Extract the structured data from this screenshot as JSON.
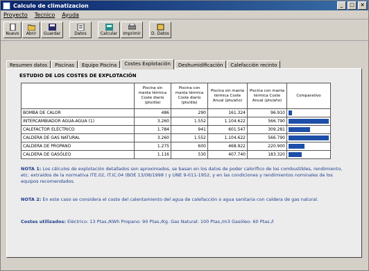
{
  "window": {
    "title": "Calculo de climatizacion"
  },
  "menu": [
    "Proyecto",
    "Tecnico",
    "Ayuda"
  ],
  "toolbar": {
    "buttons": [
      {
        "label": "Nuevo",
        "icon": "new-file-icon"
      },
      {
        "label": "Abrir",
        "icon": "open-folder-icon"
      },
      {
        "label": "Guardar",
        "icon": "save-disk-icon"
      },
      {
        "label": "Datos",
        "icon": "data-icon"
      },
      {
        "label": "Calcular",
        "icon": "calculator-icon"
      },
      {
        "label": "Imprimir",
        "icon": "printer-icon"
      },
      {
        "label": "D. Datos",
        "icon": "database-icon"
      }
    ]
  },
  "tabs": [
    "Resumen datos",
    "Piscinas",
    "Equipo Piscina",
    "Costes Explotación",
    "Deshumidificación",
    "Calefacción recinto"
  ],
  "active_tab": 3,
  "panel": {
    "title": "ESTUDIO DE LOS COSTES DE EXPLOTACIÓN",
    "columns": [
      "Piscina sin manta térmica Coste diario (pts/día)",
      "Piscina con manta térmica Coste diario (pts/día)",
      "Piscina sin manta térmica Coste Anual (pts/año)",
      "Piscina con manta térmica Coste Anual (pts/año)",
      "Comparativo"
    ],
    "rows": [
      {
        "name": "BOMBA DE CALOR",
        "v1": "486",
        "v2": "290",
        "v3": "161.324",
        "v4": "96.910",
        "bar": 0.09
      },
      {
        "name": "INTERCAMBIADOR AGUA-AGUA (1)",
        "v1": "3.260",
        "v2": "1.552",
        "v3": "1.104.622",
        "v4": "566.790",
        "bar": 1.0
      },
      {
        "name": "CALEFACTOR ELÉCTRICO",
        "v1": "1.784",
        "v2": "941",
        "v3": "601.547",
        "v4": "309.281",
        "bar": 0.54
      },
      {
        "name": "CALDERA DE GAS NATURAL",
        "v1": "3.260",
        "v2": "1.552",
        "v3": "1.104.622",
        "v4": "566.790",
        "bar": 1.0
      },
      {
        "name": "CALDERA DE PROPANO",
        "v1": "1.275",
        "v2": "600",
        "v3": "468.922",
        "v4": "220.900",
        "bar": 0.39
      },
      {
        "name": "CALDERA DE GASÓLEO",
        "v1": "1.116",
        "v2": "530",
        "v3": "407.740",
        "v4": "183.320",
        "bar": 0.33
      }
    ],
    "note1_label": "NOTA 1:",
    "note1_text": "Los cálculos de explotación detallados son aproximados, se basan en los datos de poder calorífico de los combustibles, rendimiento, etc. extraídos de la normativa ITE.02, IT.IC.04 (BOE 13/08/1998 ) y UNE 9-011-1952, y en las condiciones y rendimientos nominales de los equipos recomendados.",
    "note2_label": "NOTA 2:",
    "note2_text": "En este caso se considera el coste del calentamiento del agua de calefacción o agua sanitaria con caldera de gas natural.",
    "costs_label": "Costes utilizados:",
    "costs_text": "Eléctrico: 13 Ptas./KWh Propano: 90 Ptas./Kg. Gas Natural: 100 Ptas./m3 Gasóleo: 60 Ptas./l"
  }
}
